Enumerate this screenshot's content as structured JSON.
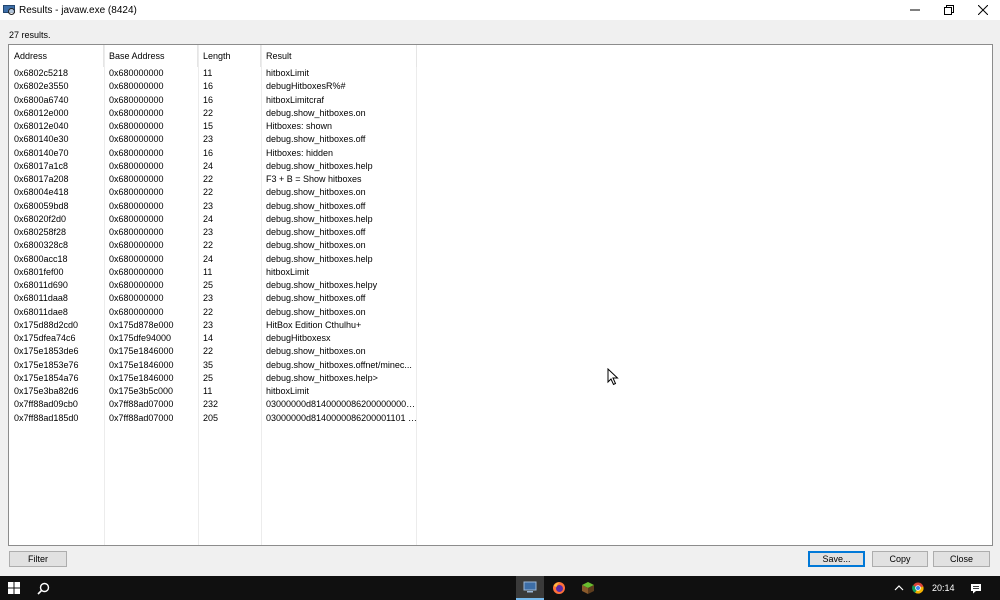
{
  "window": {
    "title": "Results - javaw.exe (8424)",
    "results_count": "27 results."
  },
  "table": {
    "headers": [
      "Address",
      "Base Address",
      "Length",
      "Result"
    ],
    "rows": [
      [
        "0x6802c5218",
        "0x680000000",
        "11",
        "hitboxLimit"
      ],
      [
        "0x6802e3550",
        "0x680000000",
        "16",
        "debugHitboxesR%#"
      ],
      [
        "0x6800a6740",
        "0x680000000",
        "16",
        "hitboxLimitcraf"
      ],
      [
        "0x68012e000",
        "0x680000000",
        "22",
        "debug.show_hitboxes.on"
      ],
      [
        "0x68012e040",
        "0x680000000",
        "15",
        "Hitboxes: shown"
      ],
      [
        "0x680140e30",
        "0x680000000",
        "23",
        "debug.show_hitboxes.off"
      ],
      [
        "0x680140e70",
        "0x680000000",
        "16",
        "Hitboxes: hidden"
      ],
      [
        "0x68017a1c8",
        "0x680000000",
        "24",
        "debug.show_hitboxes.help"
      ],
      [
        "0x68017a208",
        "0x680000000",
        "22",
        "F3 + B = Show hitboxes"
      ],
      [
        "0x68004e418",
        "0x680000000",
        "22",
        "debug.show_hitboxes.on"
      ],
      [
        "0x680059bd8",
        "0x680000000",
        "23",
        "debug.show_hitboxes.off"
      ],
      [
        "0x68020f2d0",
        "0x680000000",
        "24",
        "debug.show_hitboxes.help"
      ],
      [
        "0x680258f28",
        "0x680000000",
        "23",
        "debug.show_hitboxes.off"
      ],
      [
        "0x6800328c8",
        "0x680000000",
        "22",
        "debug.show_hitboxes.on"
      ],
      [
        "0x6800acc18",
        "0x680000000",
        "24",
        "debug.show_hitboxes.help"
      ],
      [
        "0x6801fef00",
        "0x680000000",
        "11",
        "hitboxLimit"
      ],
      [
        "0x68011d690",
        "0x680000000",
        "25",
        "debug.show_hitboxes.helpy"
      ],
      [
        "0x68011daa8",
        "0x680000000",
        "23",
        "debug.show_hitboxes.off"
      ],
      [
        "0x68011dae8",
        "0x680000000",
        "22",
        "debug.show_hitboxes.on"
      ],
      [
        "0x175d88d2cd0",
        "0x175d878e000",
        "23",
        "HitBox Edition Cthulhu+"
      ],
      [
        "0x175dfea74c6",
        "0x175dfe94000",
        "14",
        "debugHitboxesx"
      ],
      [
        "0x175e1853de6",
        "0x175e1846000",
        "22",
        "debug.show_hitboxes.on"
      ],
      [
        "0x175e1853e76",
        "0x175e1846000",
        "35",
        "debug.show_hitboxes.offnet/minec..."
      ],
      [
        "0x175e1854a76",
        "0x175e1846000",
        "25",
        "debug.show_hitboxes.help>"
      ],
      [
        "0x175e3ba82d6",
        "0x175e3b5c000",
        "11",
        "hitboxLimit"
      ],
      [
        "0x7ff88ad09cb0",
        "0x7ff88ad07000",
        "232",
        "03000000d81400000862000000000..."
      ],
      [
        "0x7ff88ad185d0",
        "0x7ff88ad07000",
        "205",
        "03000000d8140000086200001101 0..."
      ]
    ]
  },
  "buttons": {
    "filter": "Filter",
    "save": "Save...",
    "copy": "Copy",
    "close": "Close"
  },
  "taskbar": {
    "clock": "20:14",
    "items": [
      "start-icon",
      "search-icon",
      "process-hacker-icon",
      "firefox-icon",
      "minecraft-icon"
    ]
  },
  "colors": {
    "accent": "#0078d7",
    "taskbar": "#101010",
    "taskbar_active_underline": "#76b9ed"
  }
}
